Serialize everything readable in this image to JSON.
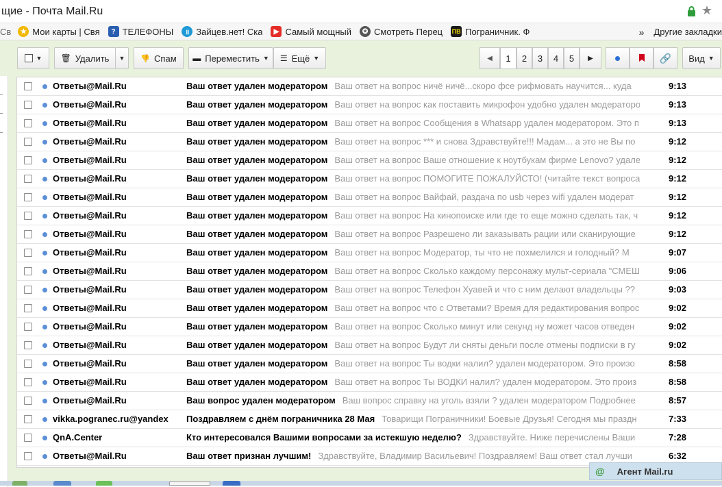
{
  "window": {
    "title": "щие - Почта Mail.Ru"
  },
  "colors": {
    "accent_green": "#e9f2dc",
    "unread_dot": "#5b8fd6",
    "snippet": "#9a9a9a"
  },
  "bookmarks": [
    {
      "label": "Св",
      "icon": "bookmark-icon"
    },
    {
      "label": "Мои карты | Свя",
      "icon": "star-icon"
    },
    {
      "label": "ТЕЛЕФОНЫ",
      "icon": "question-icon"
    },
    {
      "label": "Зайцев.нет! Ска",
      "icon": "pause-icon"
    },
    {
      "label": "Самый мощный",
      "icon": "youtube-icon"
    },
    {
      "label": "Смотреть Перец",
      "icon": "film-icon"
    },
    {
      "label": "Пограничник. Ф",
      "icon": "pv-icon"
    }
  ],
  "bookmarks_more": "»",
  "bookmarks_other": "Другие закладки",
  "toolbar": {
    "delete": "Удалить",
    "spam": "Спам",
    "move": "Переместить",
    "more": "Ещё",
    "view": "Вид",
    "pages": [
      "1",
      "2",
      "3",
      "4",
      "5"
    ],
    "current_page": "1"
  },
  "messages": [
    {
      "from": "Ответы@Mail.Ru",
      "subject": "Ваш ответ удален модератором",
      "snippet": "Ваш ответ на вопрос ничё ничё...скоро фсе рифмовать научится... куда",
      "time": "9:13"
    },
    {
      "from": "Ответы@Mail.Ru",
      "subject": "Ваш ответ удален модератором",
      "snippet": "Ваш ответ на вопрос как поставить микрофон удобно удален модератором",
      "time": "9:13"
    },
    {
      "from": "Ответы@Mail.Ru",
      "subject": "Ваш ответ удален модератором",
      "snippet": "Ваш ответ на вопрос Сообщения в Whatsapp удален модератором. Это п",
      "time": "9:13"
    },
    {
      "from": "Ответы@Mail.Ru",
      "subject": "Ваш ответ удален модератором",
      "snippet": "Ваш ответ на вопрос *** и снова Здравствуйте!!! Мадам... а это не Вы по",
      "time": "9:12"
    },
    {
      "from": "Ответы@Mail.Ru",
      "subject": "Ваш ответ удален модератором",
      "snippet": "Ваш ответ на вопрос Ваше отношение к ноутбукам фирме Lenovo? удале",
      "time": "9:12"
    },
    {
      "from": "Ответы@Mail.Ru",
      "subject": "Ваш ответ удален модератором",
      "snippet": "Ваш ответ на вопрос ПОМОГИТЕ ПОЖАЛУЙСТО! (читайте текст вопроса",
      "time": "9:12"
    },
    {
      "from": "Ответы@Mail.Ru",
      "subject": "Ваш ответ удален модератором",
      "snippet": "Ваш ответ на вопрос Вайфай, раздача по usb через wifi удален модерат",
      "time": "9:12"
    },
    {
      "from": "Ответы@Mail.Ru",
      "subject": "Ваш ответ удален модератором",
      "snippet": "Ваш ответ на вопрос На кинопоиске или где то еще можно сделать так, ч",
      "time": "9:12"
    },
    {
      "from": "Ответы@Mail.Ru",
      "subject": "Ваш ответ удален модератором",
      "snippet": "Ваш ответ на вопрос Разрешено ли заказывать рации или сканирующие",
      "time": "9:12"
    },
    {
      "from": "Ответы@Mail.Ru",
      "subject": "Ваш ответ удален модератором",
      "snippet": "Ваш ответ на вопрос Модератор, ты что не похмелился и голодный? М",
      "time": "9:07"
    },
    {
      "from": "Ответы@Mail.Ru",
      "subject": "Ваш ответ удален модератором",
      "snippet": "Ваш ответ на вопрос Сколько каждому персонажу мульт-сериала \"СМЕШ",
      "time": "9:06"
    },
    {
      "from": "Ответы@Mail.Ru",
      "subject": "Ваш ответ удален модератором",
      "snippet": "Ваш ответ на вопрос Телефон Хуавей и что с ним делают владельцы ??",
      "time": "9:03"
    },
    {
      "from": "Ответы@Mail.Ru",
      "subject": "Ваш ответ удален модератором",
      "snippet": "Ваш ответ на вопрос что с Ответами? Время для редактирования вопрос",
      "time": "9:02"
    },
    {
      "from": "Ответы@Mail.Ru",
      "subject": "Ваш ответ удален модератором",
      "snippet": "Ваш ответ на вопрос Сколько минут или секунд ну может часов отведен",
      "time": "9:02"
    },
    {
      "from": "Ответы@Mail.Ru",
      "subject": "Ваш ответ удален модератором",
      "snippet": "Ваш ответ на вопрос Будут ли сняты деньги после отмены подписки в гу",
      "time": "9:02"
    },
    {
      "from": "Ответы@Mail.Ru",
      "subject": "Ваш ответ удален модератором",
      "snippet": "Ваш ответ на вопрос Ты водки налил? удален модератором. Это произо",
      "time": "8:58"
    },
    {
      "from": "Ответы@Mail.Ru",
      "subject": "Ваш ответ удален модератором",
      "snippet": "Ваш ответ на вопрос Ты ВОДКИ налил? удален модератором. Это произ",
      "time": "8:58"
    },
    {
      "from": "Ответы@Mail.Ru",
      "subject": "Ваш вопрос удален модератором",
      "snippet": "Ваш вопрос справку на уголь взяли ? удален модератором Подробнее",
      "time": "8:57"
    },
    {
      "from": "vikka.pogranec.ru@yandex",
      "subject": "Поздравляем с днём пограничника 28 Мая",
      "snippet": "Товарищи Пограничники! Боевые Друзья! Сегодня мы праздн",
      "time": "7:33"
    },
    {
      "from": "QnA.Center",
      "subject": "Кто интересовался Вашими вопросами за истекшую неделю?",
      "snippet": "Здравствуйте. Ниже перечислены Ваши",
      "time": "7:28"
    },
    {
      "from": "Ответы@Mail.Ru",
      "subject": "Ваш ответ признан лучшим!",
      "snippet": "Здравствуйте, Владимир Васильевич! Поздравляем! Ваш ответ стал лучши",
      "time": "6:32"
    }
  ],
  "agent": {
    "icon": "@",
    "label": "Агент Mail.ru"
  }
}
